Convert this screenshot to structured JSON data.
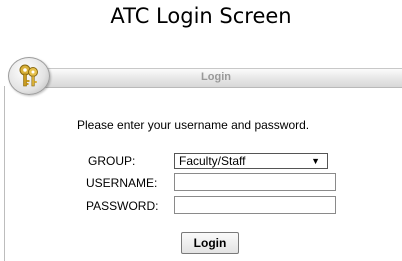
{
  "caption": "ATC Login Screen",
  "header": {
    "title": "Login"
  },
  "form": {
    "intro": "Please enter your username and password.",
    "group_label": "GROUP:",
    "group_value": "Faculty/Staff",
    "username_label": "USERNAME:",
    "username_value": "",
    "password_label": "PASSWORD:",
    "password_value": "",
    "submit_label": "Login"
  },
  "icons": {
    "badge": "keys-icon",
    "dropdown": "dropdown-arrow-icon"
  },
  "colors": {
    "header_title": "#999999",
    "header_bar": "#e6e6e6"
  }
}
